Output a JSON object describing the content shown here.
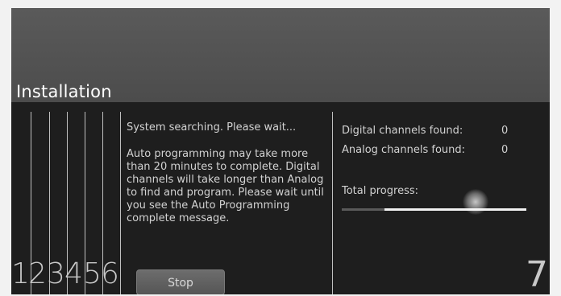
{
  "header": {
    "title": "Installation"
  },
  "steps": [
    "1",
    "2",
    "3",
    "4",
    "5",
    "6"
  ],
  "final_step": "7",
  "message": {
    "status": "System searching. Please wait...",
    "info": "Auto programming may take more than 20 minutes to complete. Digital channels will take longer than Analog to find and program. Please wait until you see the Auto Programming complete message."
  },
  "buttons": {
    "stop": "Stop"
  },
  "stats": {
    "digital_label": "Digital channels found:",
    "digital_value": "0",
    "analog_label": "Analog channels found:",
    "analog_value": "0"
  },
  "progress": {
    "label": "Total progress:",
    "value": 0.23
  }
}
